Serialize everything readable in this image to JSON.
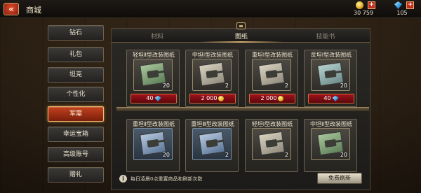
{
  "header": {
    "back_icon": "double-chevron-left-icon",
    "title": "商城",
    "gold": {
      "icon": "gold-coin-icon",
      "amount": "30 759"
    },
    "diamond": {
      "icon": "diamond-icon",
      "amount": "105"
    }
  },
  "sidebar": {
    "items": [
      {
        "label": "钻石",
        "active": false
      },
      {
        "label": "礼包",
        "active": false
      },
      {
        "label": "坦克",
        "active": false
      },
      {
        "label": "个性化",
        "active": false
      },
      {
        "label": "军需",
        "active": true
      },
      {
        "label": "幸运宝箱",
        "active": false
      },
      {
        "label": "高级账号",
        "active": false
      },
      {
        "label": "赠礼",
        "active": false
      }
    ]
  },
  "tabs": [
    {
      "label": "材料",
      "active": false
    },
    {
      "label": "图纸",
      "active": true
    },
    {
      "label": "技能书",
      "active": false
    }
  ],
  "cards": [
    {
      "name": "轻坦Ⅱ型改装图纸",
      "qty": "20",
      "price": "40",
      "currency": "diamond",
      "style": "green"
    },
    {
      "name": "中坦Ⅰ型改装图纸",
      "qty": "2",
      "price": "2 000",
      "currency": "gold",
      "style": "grey"
    },
    {
      "name": "重坦Ⅰ型改装图纸",
      "qty": "2",
      "price": "2 000",
      "currency": "gold",
      "style": "grey"
    },
    {
      "name": "反坦Ⅰ型改装图纸",
      "qty": "20",
      "price": "40",
      "currency": "diamond",
      "style": "teal"
    },
    {
      "name": "重坦Ⅱ型改装图纸",
      "qty": "20",
      "price": "",
      "currency": "",
      "style": "blue"
    },
    {
      "name": "重坦Ⅲ型改装图纸",
      "qty": "2",
      "price": "",
      "currency": "",
      "style": "blue"
    },
    {
      "name": "轻坦Ⅰ型改装图纸",
      "qty": "2",
      "price": "",
      "currency": "",
      "style": "grey"
    },
    {
      "name": "中坦Ⅱ型改装图纸",
      "qty": "20",
      "price": "",
      "currency": "",
      "style": "green"
    }
  ],
  "footer": {
    "info_icon": "info-icon",
    "notice": "每日凌晨0点重置商品和刷新次数",
    "refresh_label": "免费刷新"
  }
}
